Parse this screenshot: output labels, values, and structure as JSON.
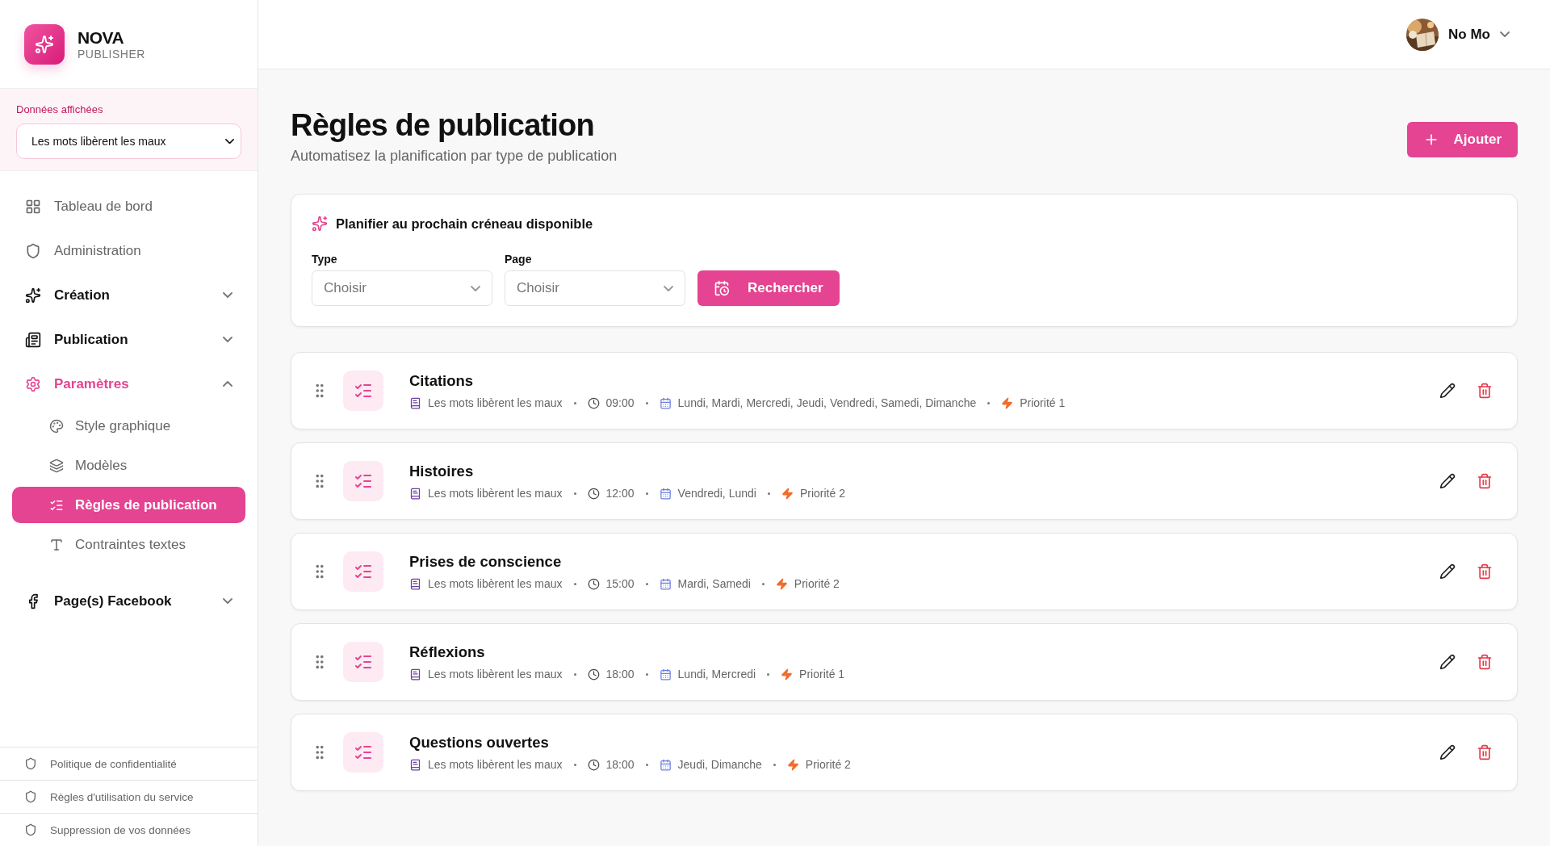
{
  "brand": {
    "name": "NOVA",
    "subtitle": "PUBLISHER"
  },
  "data_selector": {
    "label": "Données affichées",
    "value": "Les mots libèrent les maux"
  },
  "nav": [
    {
      "kind": "link",
      "label": "Tableau de bord"
    },
    {
      "kind": "link",
      "label": "Administration"
    },
    {
      "kind": "group",
      "label": "Création",
      "expanded": false
    },
    {
      "kind": "group",
      "label": "Publication",
      "expanded": false
    },
    {
      "kind": "group",
      "label": "Paramètres",
      "expanded": true,
      "children": [
        {
          "label": "Style graphique",
          "selected": false
        },
        {
          "label": "Modèles",
          "selected": false
        },
        {
          "label": "Règles de publication",
          "selected": true
        },
        {
          "label": "Contraintes textes",
          "selected": false
        }
      ]
    },
    {
      "kind": "group",
      "label": "Page(s) Facebook",
      "expanded": false
    }
  ],
  "footer_links": [
    "Politique de confidentialité",
    "Règles d'utilisation du service",
    "Suppression de vos données"
  ],
  "user": {
    "name": "No Mo"
  },
  "page": {
    "title": "Règles de publication",
    "subtitle": "Automatisez la planification par type de publication",
    "add_button": "Ajouter"
  },
  "scheduler": {
    "title": "Planifier au prochain créneau disponible",
    "fields": [
      {
        "label": "Type",
        "placeholder": "Choisir"
      },
      {
        "label": "Page",
        "placeholder": "Choisir"
      }
    ],
    "button": "Rechercher"
  },
  "rules": [
    {
      "name": "Citations",
      "page": "Les mots libèrent les maux",
      "time": "09:00",
      "days": "Lundi, Mardi, Mercredi, Jeudi, Vendredi, Samedi, Dimanche",
      "priority": "Priorité 1"
    },
    {
      "name": "Histoires",
      "page": "Les mots libèrent les maux",
      "time": "12:00",
      "days": "Vendredi, Lundi",
      "priority": "Priorité 2"
    },
    {
      "name": "Prises de conscience",
      "page": "Les mots libèrent les maux",
      "time": "15:00",
      "days": "Mardi, Samedi",
      "priority": "Priorité 2"
    },
    {
      "name": "Réflexions",
      "page": "Les mots libèrent les maux",
      "time": "18:00",
      "days": "Lundi, Mercredi",
      "priority": "Priorité 1"
    },
    {
      "name": "Questions ouvertes",
      "page": "Les mots libèrent les maux",
      "time": "18:00",
      "days": "Jeudi, Dimanche",
      "priority": "Priorité 2"
    }
  ]
}
